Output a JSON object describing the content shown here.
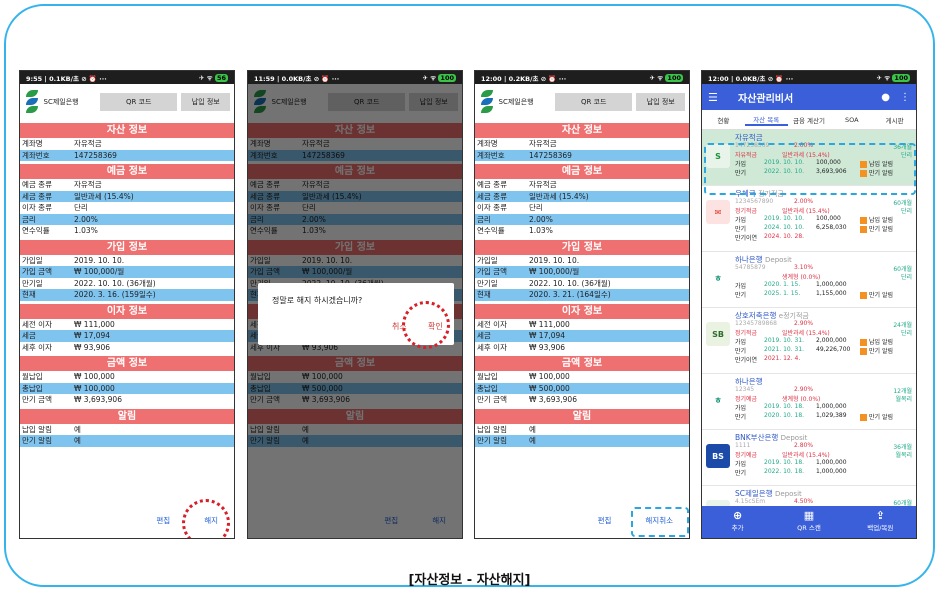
{
  "caption": "[자산정보 - 자산해지]",
  "colors": {
    "section": "#ef7070",
    "highlight": "#7fc3ef",
    "appbar": "#3a5fd9",
    "mark_red": "#d8202a",
    "mark_blue": "#2aa7e0"
  },
  "phones": [
    {
      "status_time": "9:55 | 0.1KB/초 ⊘ ⏰ ···",
      "battery": "56",
      "bank": "SC제일은행",
      "qr": "QR 코드",
      "pay": "납입 정보",
      "footer": {
        "edit": "편집",
        "action": "해지"
      },
      "current": "2020. 3. 16. (159일수)",
      "total_pay": "₩ 100,000"
    },
    {
      "status_time": "11:59 | 0.0KB/초 ⊘ ⏰ ···",
      "battery": "100",
      "bank": "SC제일은행",
      "qr": "QR 코드",
      "pay": "납입 정보",
      "footer": {
        "edit": "편집",
        "action": "해지"
      },
      "current": "2020. 3. 16. (159일수)",
      "total_pay": "₩ 500,000",
      "dialog": {
        "message": "정말로 해지 하시겠습니까?",
        "cancel": "취소",
        "ok": "확인"
      }
    },
    {
      "status_time": "12:00 | 0.2KB/초 ⊘ ⏰ ···",
      "battery": "100",
      "bank": "SC제일은행",
      "qr": "QR 코드",
      "pay": "납입 정보",
      "footer": {
        "edit": "편집",
        "action": "해지취소"
      },
      "current": "2020. 3. 21. (164일수)",
      "total_pay": "₩ 500,000"
    }
  ],
  "sections": {
    "asset": "자산 정보",
    "deposit": "예금 정보",
    "join": "가입 정보",
    "interest": "이자 정보",
    "amount": "금액 정보",
    "alarm": "알림"
  },
  "asset": {
    "account_name_k": "계좌명",
    "account_name_v": "자유적금",
    "account_no_k": "계좌번호",
    "account_no_v": "147258369"
  },
  "deposit": [
    {
      "k": "예금 종류",
      "v": "자유적금"
    },
    {
      "k": "세금 종류",
      "v": "일반과세 (15.4%)"
    },
    {
      "k": "이자 종류",
      "v": "단리"
    },
    {
      "k": "금리",
      "v": "2.00%"
    },
    {
      "k": "연수익률",
      "v": "1.03%"
    }
  ],
  "join": {
    "join_k": "가입일",
    "join_v": "2019. 10. 10.",
    "amt_k": "가입 금액",
    "amt_v": "₩ 100,000/월",
    "mat_k": "만기일",
    "mat_v": "2022. 10. 10. (36개월)",
    "cur_k": "현재"
  },
  "interest": [
    {
      "k": "세전 이자",
      "v": "₩ 111,000"
    },
    {
      "k": "세금",
      "v": "₩ 17,094"
    },
    {
      "k": "세후 이자",
      "v": "₩ 93,906"
    }
  ],
  "amount": {
    "monthly_k": "월납입",
    "monthly_v": "₩ 100,000",
    "total_k": "총납입",
    "mat_k": "만기 금액",
    "mat_v": "₩ 3,693,906"
  },
  "alarm": [
    {
      "k": "납입 알림",
      "v": "예"
    },
    {
      "k": "만기 알림",
      "v": "예"
    }
  ],
  "phone4": {
    "status_time": "12:00 | 0.0KB/초 ⊘ ⏰ ···",
    "battery": "100",
    "title": "자산관리비서",
    "tabs": [
      "현황",
      "자산 목록",
      "금융 계산기",
      "SOA",
      "게시판"
    ],
    "nav": [
      {
        "icon": "⊕",
        "label": "추가"
      },
      {
        "icon": "▦",
        "label": "QR 스캔"
      },
      {
        "icon": "⇪",
        "label": "백업/복원"
      }
    ],
    "accounts": [
      {
        "name": "자유적금",
        "sub": "",
        "acc": "147258369",
        "type": "자유적금",
        "rate": "2.00%",
        "tax": "일반과세 (15.4%)",
        "months": "36개월",
        "unit": "단리",
        "lines": [
          {
            "l": "가입",
            "d": "2019. 10. 10.",
            "a": "100,000",
            "c": "납입 알림"
          },
          {
            "l": "만기",
            "d": "2022. 10. 10.",
            "a": "3,693,906",
            "c": "만기 알림"
          }
        ],
        "logo": "S",
        "logo_bg": "#e8f4ea",
        "logo_fg": "#1a8f3c"
      },
      {
        "name": "우체국",
        "sub": "정기적금",
        "acc": "1234567890",
        "type": "정기적금",
        "rate": "2.00%",
        "tax": "일반과세 (15.4%)",
        "months": "60개월",
        "unit": "단리",
        "lines": [
          {
            "l": "가입",
            "d": "2019. 10. 10.",
            "a": "100,000",
            "c": "납입 알림"
          },
          {
            "l": "만기",
            "d": "2024. 10. 10.",
            "a": "6,258,030",
            "c": "만기 알림"
          },
          {
            "l": "만기이연",
            "d": "2024. 10. 28.",
            "a": "",
            "c": ""
          }
        ],
        "logo": "✉",
        "logo_bg": "#fde2e2",
        "logo_fg": "#d32"
      },
      {
        "name": "하나은행",
        "sub": "Deposit",
        "acc": "54785879",
        "type": "",
        "rate": "3.10%",
        "tax": "생계형 (0.0%)",
        "months": "60개월",
        "unit": "단리",
        "lines": [
          {
            "l": "가입",
            "d": "2020. 1. 15.",
            "a": "1,000,000",
            "c": ""
          },
          {
            "l": "만기",
            "d": "2025. 1. 15.",
            "a": "1,155,000",
            "c": "만기 알림"
          }
        ],
        "logo": "ㅎ",
        "logo_bg": "#fff",
        "logo_fg": "#0a8f6f"
      },
      {
        "name": "상호저축은행",
        "sub": "e정기적금",
        "acc": "12345789868",
        "type": "정기적금",
        "rate": "2.90%",
        "tax": "일반과세 (15.4%)",
        "months": "24개월",
        "unit": "단리",
        "lines": [
          {
            "l": "가입",
            "d": "2019. 10. 31.",
            "a": "2,000,000",
            "c": "납입 알림"
          },
          {
            "l": "만기",
            "d": "2021. 10. 31.",
            "a": "49,226,700",
            "c": "만기 알림"
          },
          {
            "l": "만기이연",
            "d": "2021. 12. 4.",
            "a": "",
            "c": ""
          }
        ],
        "logo": "SB",
        "logo_bg": "#eaf3e2",
        "logo_fg": "#2b6d2b"
      },
      {
        "name": "하나은행",
        "sub": "",
        "acc": "12345",
        "type": "정기예금",
        "rate": "2.90%",
        "tax": "생계형 (0.0%)",
        "months": "12개월",
        "unit": "월복리",
        "lines": [
          {
            "l": "가입",
            "d": "2019. 10. 18.",
            "a": "1,000,000",
            "c": ""
          },
          {
            "l": "만기",
            "d": "2020. 10. 18.",
            "a": "1,029,389",
            "c": "만기 알림"
          }
        ],
        "logo": "ㅎ",
        "logo_bg": "#fff",
        "logo_fg": "#0a8f6f"
      },
      {
        "name": "BNK부산은행",
        "sub": "Deposit",
        "acc": "1111",
        "type": "정기예금",
        "rate": "2.80%",
        "tax": "일반과세 (15.4%)",
        "months": "36개월",
        "unit": "월복리",
        "lines": [
          {
            "l": "가입",
            "d": "2019. 10. 18.",
            "a": "1,000,000",
            "c": ""
          },
          {
            "l": "만기",
            "d": "2022. 10. 18.",
            "a": "1,000,000",
            "c": ""
          }
        ],
        "logo": "BS",
        "logo_bg": "#1b4aa8",
        "logo_fg": "#fff"
      },
      {
        "name": "SC제일은행",
        "sub": "Deposit",
        "acc": "4.15cSEm",
        "type": "정기예금",
        "rate": "4.50%",
        "tax": "생계형 (0.0%)",
        "months": "60개월",
        "unit": "단리",
        "lines": [
          {
            "l": "가입",
            "d": "2019. 10. 18.",
            "a": "1,000,000",
            "c": ""
          },
          {
            "l": "만기",
            "d": "2024. 10. 18.",
            "a": "1,225,000",
            "c": "만기 알림"
          }
        ],
        "logo": "S",
        "logo_bg": "#e8f4ea",
        "logo_fg": "#1a8f3c"
      }
    ]
  }
}
